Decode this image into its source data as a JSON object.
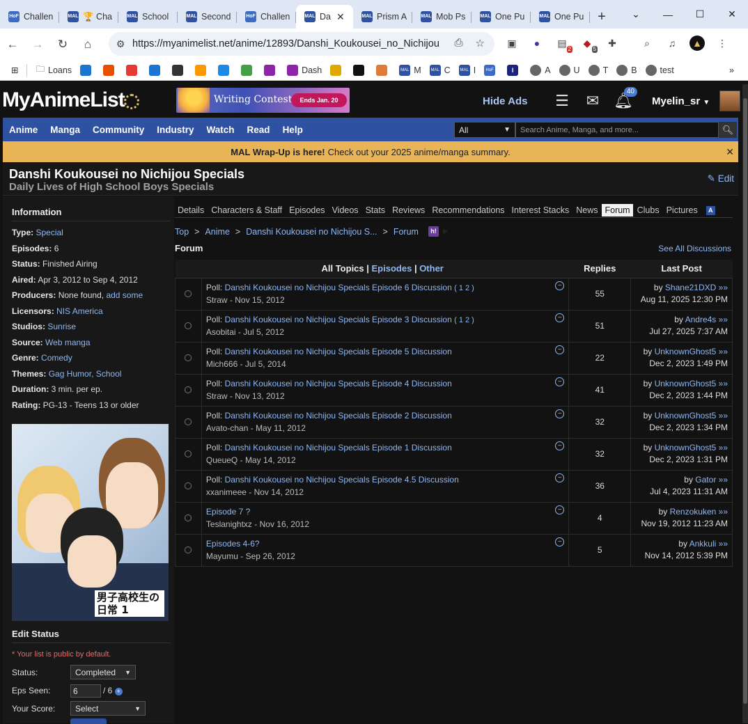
{
  "browser": {
    "tabs": [
      {
        "icon": "HoF",
        "title": "Challen"
      },
      {
        "icon": "MAL",
        "title": "🏆 Cha"
      },
      {
        "icon": "MAL",
        "title": "School"
      },
      {
        "icon": "MAL",
        "title": "Second"
      },
      {
        "icon": "HoF",
        "title": "Challen"
      },
      {
        "icon": "MAL",
        "title": "Da",
        "active": true
      },
      {
        "icon": "MAL",
        "title": "Prism A"
      },
      {
        "icon": "MAL",
        "title": "Mob Ps"
      },
      {
        "icon": "MAL",
        "title": "One Pu"
      },
      {
        "icon": "MAL",
        "title": "One Pu"
      }
    ],
    "url": "https://myanimelist.net/anime/12893/Danshi_Koukousei_no_Nichijou...",
    "ext_badge_1": "2",
    "ext_badge_2": "5",
    "bookmarks": [
      "Loans",
      "Dash",
      "M",
      "C",
      "I",
      "A",
      "U",
      "T",
      "B",
      "test"
    ]
  },
  "site": {
    "logo": "MyAnimeList",
    "promo_title": "Writing Contest",
    "promo_ends": "Ends Jan. 20",
    "hide_ads": "Hide Ads",
    "notif_count": "40",
    "username": "Myelin_sr",
    "nav": [
      "Anime",
      "Manga",
      "Community",
      "Industry",
      "Watch",
      "Read",
      "Help"
    ],
    "search_category": "All",
    "search_placeholder": "Search Anime, Manga, and more...",
    "wrapup_bold": "MAL Wrap-Up is here!",
    "wrapup_text": "Check out your 2025 anime/manga summary."
  },
  "anime": {
    "title": "Danshi Koukousei no Nichijou Specials",
    "title_en": "Daily Lives of High School Boys Specials",
    "edit": "Edit"
  },
  "info": {
    "heading": "Information",
    "rows": [
      {
        "k": "Type:",
        "v": "Special",
        "link": true
      },
      {
        "k": "Episodes:",
        "v": "6"
      },
      {
        "k": "Status:",
        "v": "Finished Airing"
      },
      {
        "k": "Aired:",
        "v": "Apr 3, 2012 to Sep 4, 2012"
      },
      {
        "k": "Producers:",
        "v": "None found,",
        "v2": "add some"
      },
      {
        "k": "Licensors:",
        "v": "NIS America",
        "link": true
      },
      {
        "k": "Studios:",
        "v": "Sunrise",
        "link": true
      },
      {
        "k": "Source:",
        "v": "Web manga",
        "link": true
      },
      {
        "k": "Genre:",
        "v": "Comedy",
        "link": true
      },
      {
        "k": "Themes:",
        "v": "Gag Humor",
        "v2": ", School",
        "link": true
      },
      {
        "k": "Duration:",
        "v": "3 min. per ep."
      },
      {
        "k": "Rating:",
        "v": "PG-13 - Teens 13 or older"
      }
    ],
    "poster_logo": "男子高校生の日常 1"
  },
  "edit_status": {
    "heading": "Edit Status",
    "note": "* Your list is public by default.",
    "status_label": "Status:",
    "status_value": "Completed",
    "eps_label": "Eps Seen:",
    "eps_value": "6",
    "eps_total": "/ 6",
    "score_label": "Your Score:",
    "score_value": "Select"
  },
  "subtabs": [
    "Details",
    "Characters & Staff",
    "Episodes",
    "Videos",
    "Stats",
    "Reviews",
    "Recommendations",
    "Interest Stacks",
    "News",
    "Forum",
    "Clubs",
    "Pictures"
  ],
  "breadcrumbs": [
    "Top",
    "Anime",
    "Danshi Koukousei no Nichijou S...",
    "Forum"
  ],
  "hbadge": "h!",
  "forum": {
    "heading": "Forum",
    "see_all": "See All Discussions",
    "col_all": "All Topics",
    "col_eps": "Episodes",
    "col_other": "Other",
    "col_replies": "Replies",
    "col_last": "Last Post",
    "rows": [
      {
        "poll": "Poll:",
        "title": "Danshi Koukousei no Nichijou Specials Episode 6 Discussion",
        "pages": "( 1 2 )",
        "author": "Straw",
        "date": "Nov 15, 2012",
        "replies": "55",
        "by": "Shane21DXD",
        "last": "Aug 11, 2025 12:30 PM"
      },
      {
        "poll": "Poll:",
        "title": "Danshi Koukousei no Nichijou Specials Episode 3 Discussion",
        "pages": "( 1 2 )",
        "author": "Asobitai",
        "date": "Jul 5, 2012",
        "replies": "51",
        "by": "Andre4s",
        "last": "Jul 27, 2025 7:37 AM"
      },
      {
        "poll": "Poll:",
        "title": "Danshi Koukousei no Nichijou Specials Episode 5 Discussion",
        "pages": "",
        "author": "Mich666",
        "date": "Jul 5, 2014",
        "replies": "22",
        "by": "UnknownGhost5",
        "last": "Dec 2, 2023 1:49 PM"
      },
      {
        "poll": "Poll:",
        "title": "Danshi Koukousei no Nichijou Specials Episode 4 Discussion",
        "pages": "",
        "author": "Straw",
        "date": "Nov 13, 2012",
        "replies": "41",
        "by": "UnknownGhost5",
        "last": "Dec 2, 2023 1:44 PM"
      },
      {
        "poll": "Poll:",
        "title": "Danshi Koukousei no Nichijou Specials Episode 2 Discussion",
        "pages": "",
        "author": "Avato-chan",
        "date": "May 11, 2012",
        "replies": "32",
        "by": "UnknownGhost5",
        "last": "Dec 2, 2023 1:34 PM"
      },
      {
        "poll": "Poll:",
        "title": "Danshi Koukousei no Nichijou Specials Episode 1 Discussion",
        "pages": "",
        "author": "QueueQ",
        "date": "May 14, 2012",
        "replies": "32",
        "by": "UnknownGhost5",
        "last": "Dec 2, 2023 1:31 PM"
      },
      {
        "poll": "Poll:",
        "title": "Danshi Koukousei no Nichijou Specials Episode 4.5 Discussion",
        "pages": "",
        "author": "xxanimeee",
        "date": "Nov 14, 2012",
        "replies": "36",
        "by": "Gator",
        "last": "Jul 4, 2023 11:31 AM"
      },
      {
        "poll": "",
        "title": "Episode 7 ?",
        "pages": "",
        "author": "Teslanightxz",
        "date": "Nov 16, 2012",
        "replies": "4",
        "by": "Renzokuken",
        "last": "Nov 19, 2012 11:23 AM"
      },
      {
        "poll": "",
        "title": "Episodes 4-6?",
        "pages": "",
        "author": "Mayumu",
        "date": "Sep 26, 2012",
        "replies": "5",
        "by": "Ankkuli",
        "last": "Nov 14, 2012 5:39 PM"
      }
    ]
  }
}
